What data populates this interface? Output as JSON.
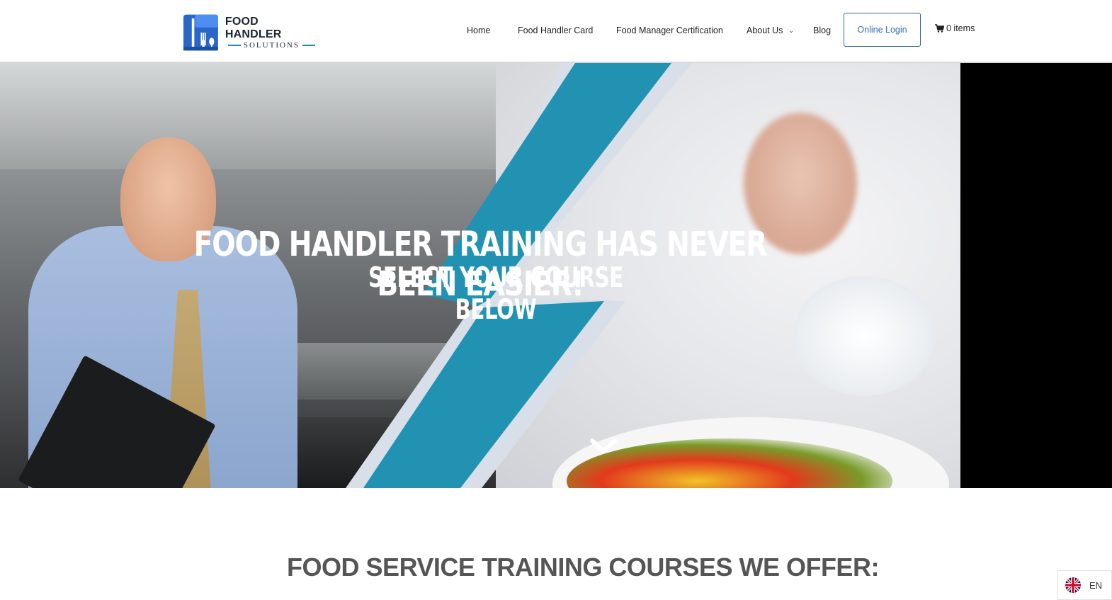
{
  "brand": {
    "logo_line1": "FOOD HANDLER",
    "logo_line2": "SOLUTIONS",
    "colors": {
      "primary": "#2a66c8",
      "accent": "#1e90b8",
      "dark": "#1b2433"
    }
  },
  "nav": {
    "items": [
      {
        "label": "Home"
      },
      {
        "label": "Food Handler Card"
      },
      {
        "label": "Food Manager Certification"
      },
      {
        "label": "About Us",
        "has_dropdown": true
      },
      {
        "label": "Blog"
      }
    ],
    "login_label": "Online Login",
    "cart_label": "0 items",
    "cart_icon": "cart-icon"
  },
  "hero": {
    "headline": "FOOD HANDLER TRAINING HAS NEVER BEEN EASIER!",
    "subheadline": "SELECT YOUR COURSE BELOW",
    "scroll_icon": "chevron-down-icon",
    "accent_color": "#2192b2"
  },
  "section": {
    "title": "FOOD SERVICE TRAINING COURSES WE OFFER:"
  },
  "language": {
    "code": "EN",
    "flag_icon": "uk-flag-icon"
  }
}
